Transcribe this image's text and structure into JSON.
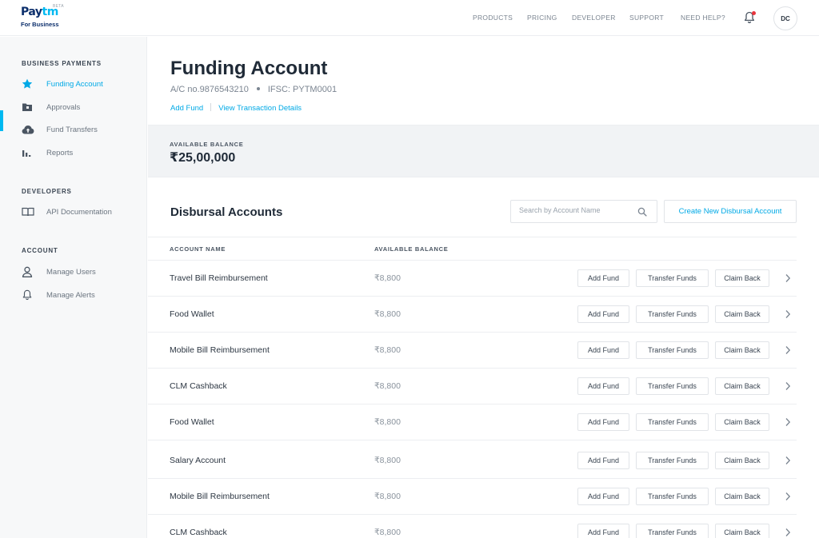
{
  "header": {
    "logo_paytm_1": "Pay",
    "logo_paytm_2": "tm",
    "logo_beta": "BETA",
    "logo_sub": "For Business",
    "nav": [
      "PRODUCTS",
      "PRICING",
      "DEVELOPER",
      "SUPPORT",
      "NEED HELP?"
    ],
    "avatar_initials": "DC",
    "icons": {
      "notifications": "bell-icon"
    }
  },
  "sidebar": {
    "sections": [
      {
        "title": "BUSINESS PAYMENTS",
        "items": [
          {
            "label": "Funding Account",
            "icon": "star-icon",
            "active": true
          },
          {
            "label": "Approvals",
            "icon": "folder-icon"
          },
          {
            "label": "Fund Transfers",
            "icon": "cloud-upload-icon"
          },
          {
            "label": "Reports",
            "icon": "bar-chart-icon"
          }
        ]
      },
      {
        "title": "DEVELOPERS",
        "items": [
          {
            "label": "API Documentation",
            "icon": "book-icon"
          }
        ]
      },
      {
        "title": "ACCOUNT",
        "items": [
          {
            "label": "Manage Users",
            "icon": "user-icon"
          },
          {
            "label": "Manage Alerts",
            "icon": "bell-icon"
          }
        ]
      }
    ]
  },
  "main": {
    "title": "Funding Account",
    "account_no": "A/C no.9876543210",
    "ifsc": "IFSC: PYTM0001",
    "add_fund_link": "Add Fund",
    "view_transactions_link": "View Transaction Details",
    "balance_label": "AVAILABLE BALANCE",
    "balance_value": "₹25,00,000",
    "section_title": "Disbursal Accounts",
    "search_placeholder": "Search by Account Name",
    "create_button": "Create New Disbursal Account",
    "columns": [
      "ACCOUNT NAME",
      "AVAILABLE BALANCE"
    ],
    "row_actions": [
      "Add Fund",
      "Transfer Funds",
      "Claim Back"
    ],
    "rows": [
      {
        "name": "Travel Bill Reimbursement",
        "balance": "₹8,800"
      },
      {
        "name": "Food Wallet",
        "balance": "₹8,800"
      },
      {
        "name": "Mobile Bill Reimbursement",
        "balance": "₹8,800"
      },
      {
        "name": "CLM Cashback",
        "balance": "₹8,800"
      },
      {
        "name": "Food Wallet",
        "balance": "₹8,800"
      },
      {
        "name": "Salary Account",
        "balance": "₹8,800"
      },
      {
        "name": "Mobile Bill Reimbursement",
        "balance": "₹8,800"
      },
      {
        "name": "CLM Cashback",
        "balance": "₹8,800"
      }
    ]
  },
  "colors": {
    "accent": "#00b9f1",
    "link": "#00a9e6",
    "brand_dark": "#0b2e6b",
    "notification_dot": "#e8343d"
  }
}
